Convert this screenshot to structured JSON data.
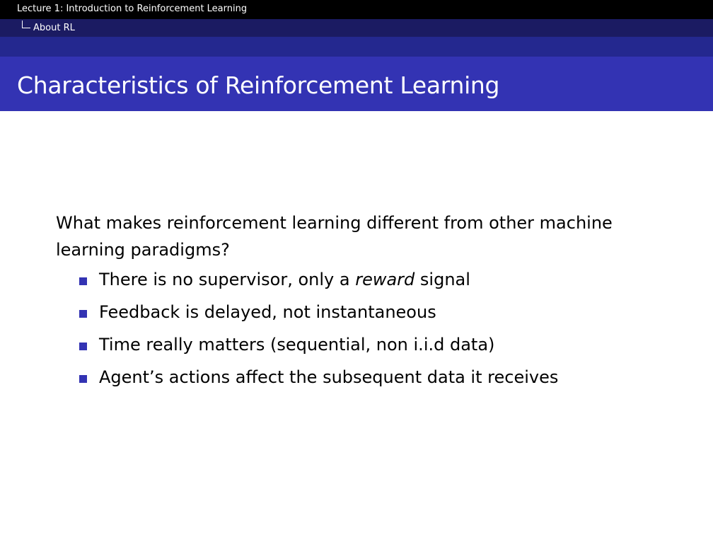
{
  "header": {
    "lecture_title": "Lecture 1: Introduction to Reinforcement Learning",
    "section": "About RL"
  },
  "slide": {
    "title": "Characteristics of Reinforcement Learning",
    "intro": "What makes reinforcement learning different from other machine learning paradigms?",
    "bullets": [
      {
        "before": "There is no supervisor, only a ",
        "emphasis": "reward",
        "after": " signal"
      },
      {
        "text": "Feedback is delayed, not instantaneous"
      },
      {
        "text": "Time really matters (sequential, non i.i.d data)"
      },
      {
        "text": "Agent’s actions affect the subsequent data it receives"
      }
    ]
  },
  "colors": {
    "header_black": "#000000",
    "header_sub": "#1b1b62",
    "header_band": "#24288f",
    "title_bar": "#3333b3",
    "bullet": "#3333b3"
  },
  "icons": {
    "tree": "tree-branch-icon",
    "bullet": "square-bullet-icon"
  }
}
